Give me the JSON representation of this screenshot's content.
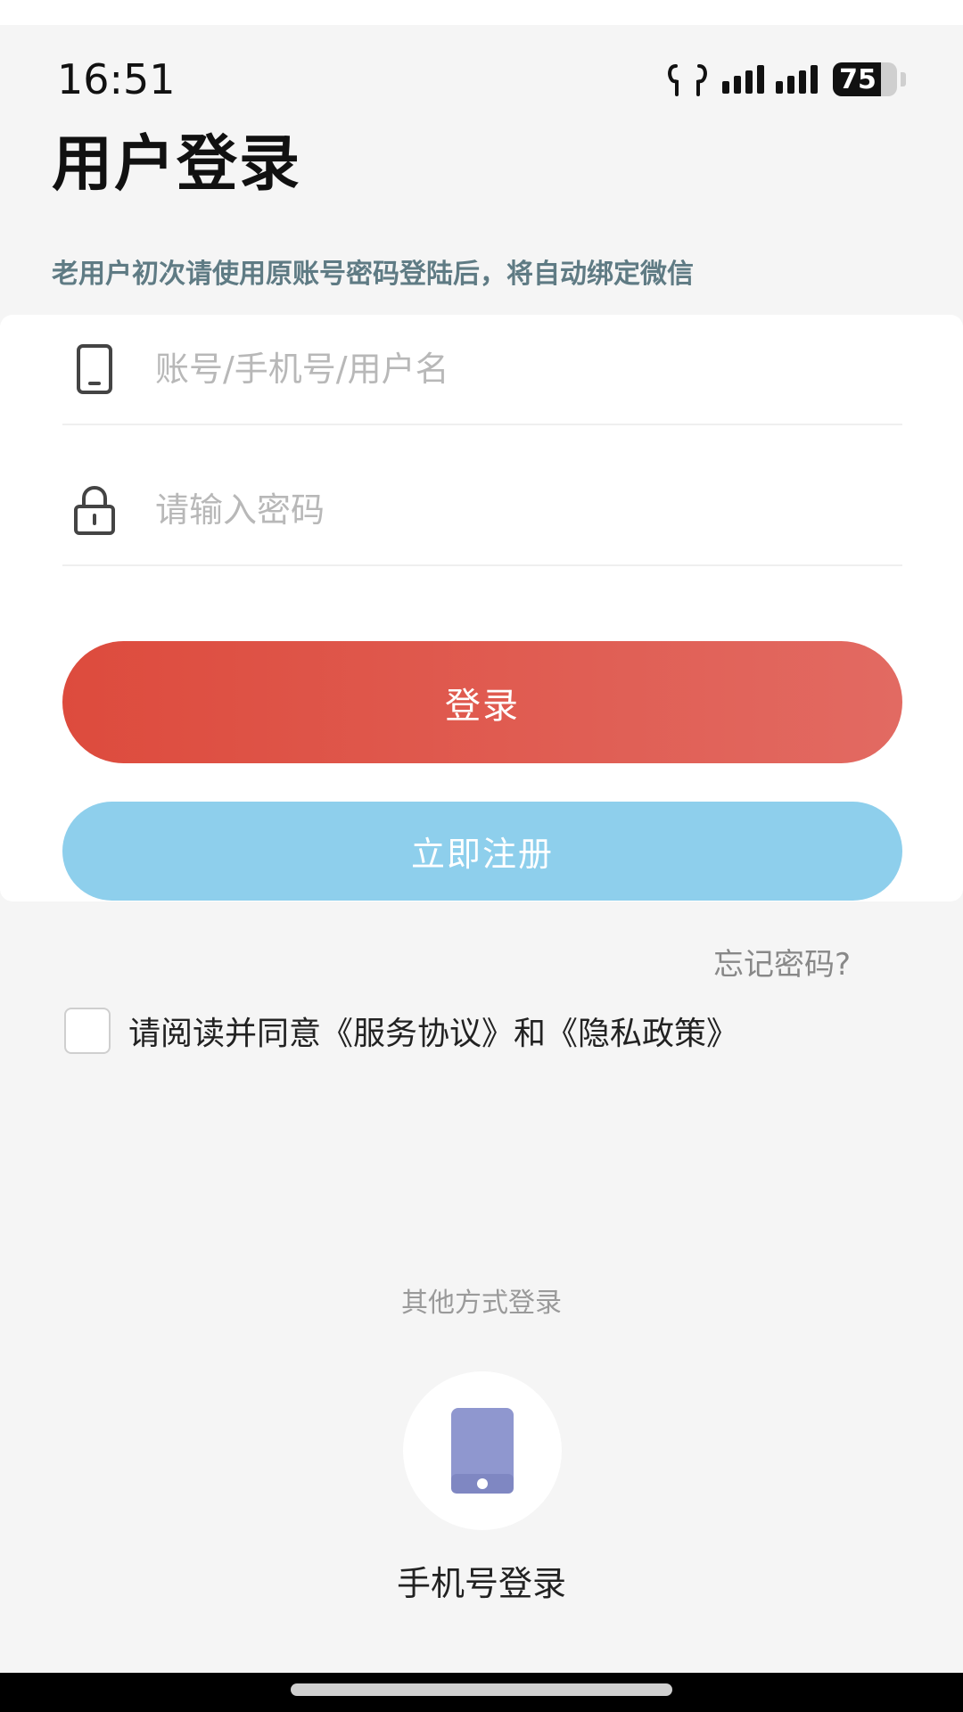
{
  "status_bar": {
    "time": "16:51",
    "battery_level": "75"
  },
  "title": "用户登录",
  "notice": "老用户初次请使用原账号密码登陆后，将自动绑定微信",
  "form": {
    "account_placeholder": "账号/手机号/用户名",
    "account_value": "",
    "password_placeholder": "请输入密码",
    "password_value": "",
    "login_label": "登录",
    "register_label": "立即注册",
    "forgot_label": "忘记密码?"
  },
  "agreement": {
    "text": "请阅读并同意《服务协议》和《隐私政策》",
    "checked": false
  },
  "other_login": {
    "label": "其他方式登录",
    "phone_login_label": "手机号登录"
  },
  "colors": {
    "login_button": "#dd4b3d",
    "register_button": "#8ecfec",
    "notice_text": "#5f7b84",
    "phone_icon": "#8f97cf"
  },
  "icons": {
    "status": [
      "earbuds-icon",
      "signal-icon",
      "signal-icon",
      "battery-icon"
    ],
    "account_field": "phone-icon",
    "password_field": "lock-icon",
    "phone_login": "phone-icon"
  }
}
